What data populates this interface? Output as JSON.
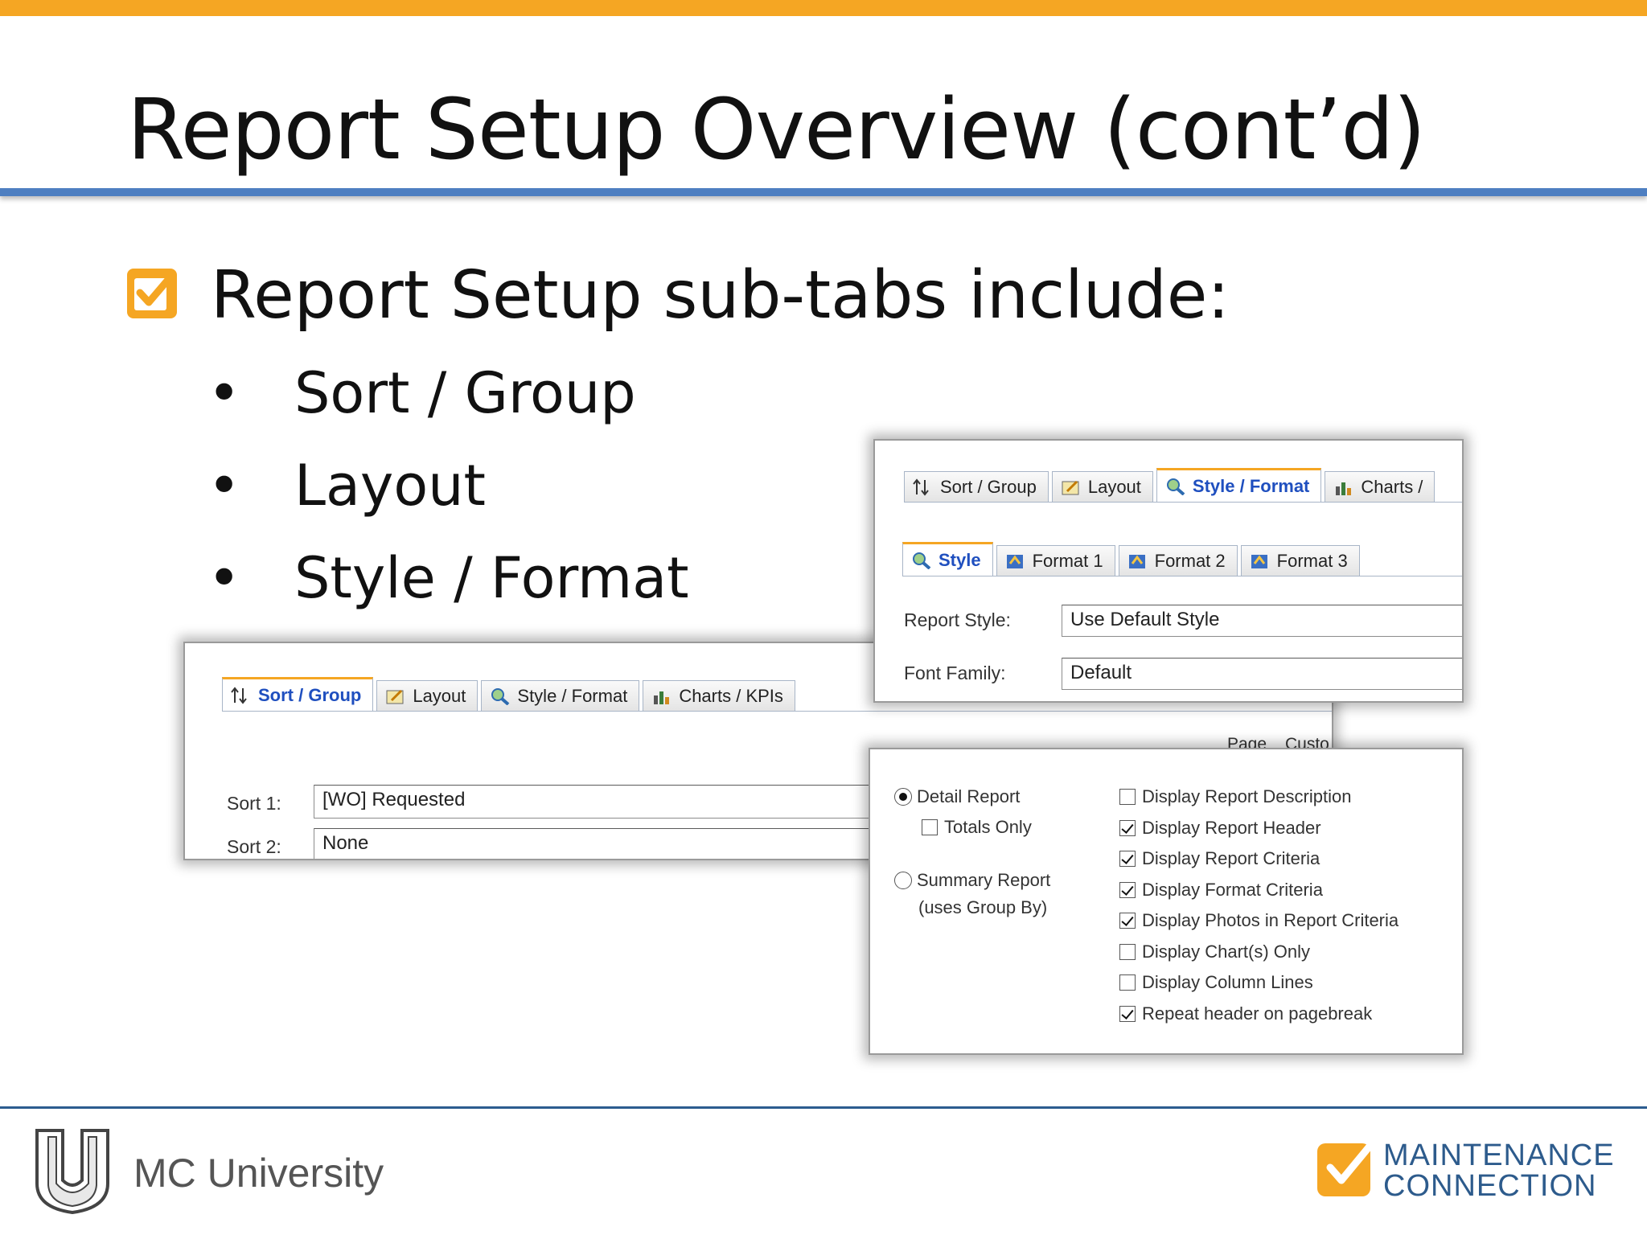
{
  "slide": {
    "title": "Report Setup Overview (cont’d)",
    "main_bullet": "Report Setup sub-tabs include:",
    "sub_items": [
      "Sort / Group",
      "Layout",
      "Style / Format"
    ],
    "bullet_char": "•"
  },
  "sort_panel": {
    "tabs": [
      "Sort / Group",
      "Layout",
      "Style / Format",
      "Charts / KPIs"
    ],
    "active_tab": "Sort / Group",
    "sort1_label": "Sort 1:",
    "sort1_value": "[WO] Requested",
    "sort2_label": "Sort 2:",
    "sort2_value": "None",
    "page_label": "Page",
    "custom_label_partial": "Custo"
  },
  "style_panel": {
    "tabs": [
      "Sort / Group",
      "Layout",
      "Style / Format",
      "Charts /"
    ],
    "active_tab": "Style / Format",
    "subtabs": [
      "Style",
      "Format 1",
      "Format 2",
      "Format 3"
    ],
    "active_subtab": "Style",
    "report_style_label": "Report Style:",
    "report_style_value": "Use Default Style",
    "font_family_label": "Font Family:",
    "font_family_value": "Default"
  },
  "options_panel": {
    "report_types": [
      {
        "label": "Detail Report",
        "selected": true
      },
      {
        "label": "Summary Report",
        "selected": false
      }
    ],
    "totals_only": {
      "label": "Totals Only",
      "checked": false
    },
    "summary_note": "(uses Group By)",
    "display_options": [
      {
        "label": "Display Report Description",
        "checked": false
      },
      {
        "label": "Display Report Header",
        "checked": true
      },
      {
        "label": "Display Report Criteria",
        "checked": true
      },
      {
        "label": "Display Format Criteria",
        "checked": true
      },
      {
        "label": "Display Photos in Report Criteria",
        "checked": true
      },
      {
        "label": "Display Chart(s) Only",
        "checked": false
      },
      {
        "label": "Display Column Lines",
        "checked": false
      },
      {
        "label": "Repeat header on pagebreak",
        "checked": true
      }
    ]
  },
  "footer": {
    "org": "MC University",
    "brand_line1": "MAINTENANCE",
    "brand_line2": "CONNECTION"
  },
  "colors": {
    "accent_orange": "#f5a623",
    "rule_blue": "#4e7fc1",
    "footer_blue": "#2c5c8f",
    "active_tab_text": "#1f4fbf"
  }
}
